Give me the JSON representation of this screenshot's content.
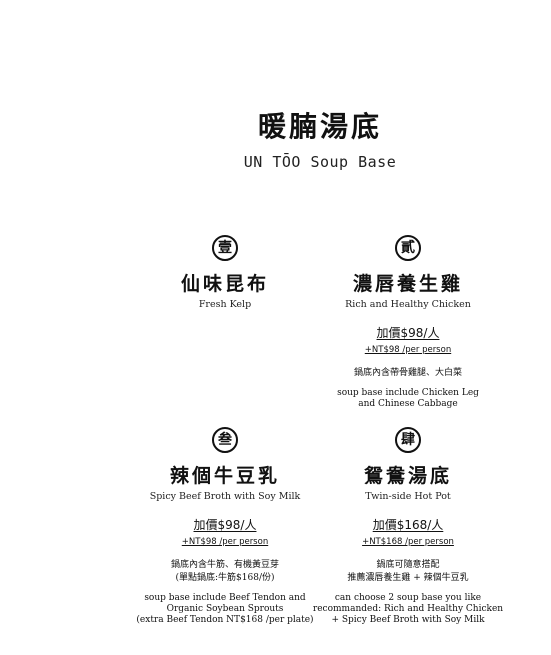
{
  "header": {
    "title_zh": "暖腩湯底",
    "title_en": "UN TŌO Soup Base"
  },
  "items": [
    {
      "numeral": "壹",
      "name_zh": "仙味昆布",
      "name_en": "Fresh Kelp"
    },
    {
      "numeral": "貳",
      "name_zh": "濃唇養生雞",
      "name_en": "Rich and Healthy Chicken",
      "price": "加價$98/人",
      "price_sub": "+NT$98 /per person",
      "desc_zh": [
        "鍋底內含帶骨雞腿、大白菜"
      ],
      "desc_en": [
        "soup base include Chicken Leg",
        "and Chinese Cabbage"
      ]
    },
    {
      "numeral": "叁",
      "name_zh": "辣個牛豆乳",
      "name_en": "Spicy Beef Broth with Soy Milk",
      "price": "加價$98/人",
      "price_sub": "+NT$98 /per person",
      "desc_zh": [
        "鍋底內含牛筋、有機黃豆芽",
        "(單點鍋底:牛筋$168/份)"
      ],
      "desc_en": [
        "soup base include Beef Tendon and",
        "Organic Soybean Sprouts",
        "(extra Beef Tendon NT$168 /per plate)"
      ]
    },
    {
      "numeral": "肆",
      "name_zh": "鴛鴦湯底",
      "name_en": "Twin-side Hot Pot",
      "price": "加價$168/人",
      "price_sub": "+NT$168 /per person",
      "desc_zh": [
        "鍋底可隨意搭配",
        "推薦濃唇養生雞 + 辣個牛豆乳"
      ],
      "desc_en": [
        "can choose 2 soup base you like",
        "recommanded: Rich and Healthy Chicken",
        "+ Spicy Beef Broth with Soy Milk"
      ]
    }
  ]
}
